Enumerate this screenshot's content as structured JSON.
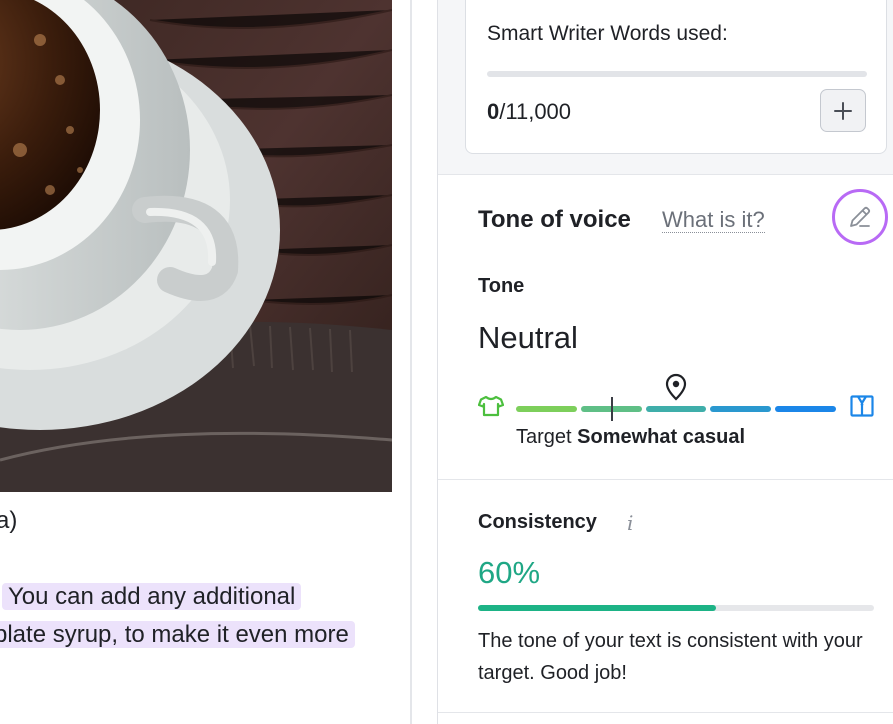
{
  "document": {
    "line_1": "a)",
    "line_2": "You can add any additional",
    "line_3": "plate syrup, to make it even more"
  },
  "usage": {
    "title": "Smart Writer Words used:",
    "used": "0",
    "limit": "/11,000",
    "fraction": 0,
    "add_label": "+"
  },
  "tone": {
    "title": "Tone of voice",
    "help_link": "What is it?",
    "label": "Tone",
    "value": "Neutral",
    "target_prefix": "Target",
    "target_value": "Somewhat casual",
    "scale_colors": [
      "#7dcf5b",
      "#5fbf86",
      "#3faeaa",
      "#2a98cf",
      "#1b86e8"
    ],
    "casual_icon": "t-shirt-icon",
    "formal_icon": "suit-icon",
    "edit_icon": "pencil-icon"
  },
  "consistency": {
    "title": "Consistency",
    "info_icon": "i",
    "value": "60%",
    "fraction": 0.6,
    "message": "The tone of your text is consistent with your target. Good job!"
  }
}
